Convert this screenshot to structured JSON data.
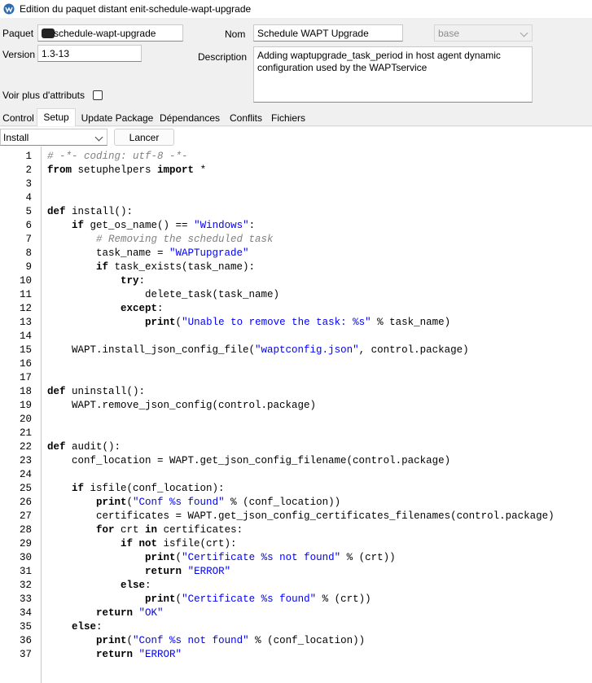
{
  "window": {
    "title": "Edition du paquet distant enit-schedule-wapt-upgrade"
  },
  "form": {
    "paquet_label": "Paquet",
    "paquet_value": "schedule-wapt-upgrade",
    "version_label": "Version",
    "version_value": "1.3-13",
    "nom_label": "Nom",
    "nom_value": "Schedule WAPT Upgrade",
    "base_value": "base",
    "description_label": "Description",
    "description_value": "Adding waptupgrade_task_period in host agent dynamic configuration used by the WAPTservice",
    "more_attrs_label": "Voir plus d'attributs",
    "more_attrs_checked": false
  },
  "tabs": [
    {
      "label": "Control",
      "active": false
    },
    {
      "label": "Setup",
      "active": true
    },
    {
      "label": "Update Package",
      "active": false
    },
    {
      "label": "Dépendances",
      "active": false
    },
    {
      "label": "Conflits",
      "active": false
    },
    {
      "label": "Fichiers",
      "active": false
    }
  ],
  "toolbar": {
    "action_value": "Install",
    "run_label": "Lancer"
  },
  "editor": {
    "lines": [
      [
        [
          "c",
          "# -*- coding: utf-8 -*-"
        ]
      ],
      [
        [
          "k",
          "from"
        ],
        [
          "p",
          " setuphelpers "
        ],
        [
          "k",
          "import"
        ],
        [
          "p",
          " *"
        ]
      ],
      [],
      [],
      [
        [
          "k",
          "def"
        ],
        [
          "p",
          " install():"
        ]
      ],
      [
        [
          "p",
          "    "
        ],
        [
          "k",
          "if"
        ],
        [
          "p",
          " get_os_name() == "
        ],
        [
          "s",
          "\"Windows\""
        ],
        [
          "p",
          ":"
        ]
      ],
      [
        [
          "p",
          "        "
        ],
        [
          "c",
          "# Removing the scheduled task"
        ]
      ],
      [
        [
          "p",
          "        task_name = "
        ],
        [
          "s",
          "\"WAPTupgrade\""
        ]
      ],
      [
        [
          "p",
          "        "
        ],
        [
          "k",
          "if"
        ],
        [
          "p",
          " task_exists(task_name):"
        ]
      ],
      [
        [
          "p",
          "            "
        ],
        [
          "k",
          "try"
        ],
        [
          "p",
          ":"
        ]
      ],
      [
        [
          "p",
          "                delete_task(task_name)"
        ]
      ],
      [
        [
          "p",
          "            "
        ],
        [
          "k",
          "except"
        ],
        [
          "p",
          ":"
        ]
      ],
      [
        [
          "p",
          "                "
        ],
        [
          "k",
          "print"
        ],
        [
          "p",
          "("
        ],
        [
          "s",
          "\"Unable to remove the task: %s\""
        ],
        [
          "p",
          " % task_name)"
        ]
      ],
      [],
      [
        [
          "p",
          "    WAPT.install_json_config_file("
        ],
        [
          "s",
          "\"waptconfig.json\""
        ],
        [
          "p",
          ", control.package)"
        ]
      ],
      [],
      [],
      [
        [
          "k",
          "def"
        ],
        [
          "p",
          " uninstall():"
        ]
      ],
      [
        [
          "p",
          "    WAPT.remove_json_config(control.package)"
        ]
      ],
      [],
      [],
      [
        [
          "k",
          "def"
        ],
        [
          "p",
          " audit():"
        ]
      ],
      [
        [
          "p",
          "    conf_location = WAPT.get_json_config_filename(control.package)"
        ]
      ],
      [],
      [
        [
          "p",
          "    "
        ],
        [
          "k",
          "if"
        ],
        [
          "p",
          " isfile(conf_location):"
        ]
      ],
      [
        [
          "p",
          "        "
        ],
        [
          "k",
          "print"
        ],
        [
          "p",
          "("
        ],
        [
          "s",
          "\"Conf %s found\""
        ],
        [
          "p",
          " % (conf_location))"
        ]
      ],
      [
        [
          "p",
          "        certificates = WAPT.get_json_config_certificates_filenames(control.package)"
        ]
      ],
      [
        [
          "p",
          "        "
        ],
        [
          "k",
          "for"
        ],
        [
          "p",
          " crt "
        ],
        [
          "k",
          "in"
        ],
        [
          "p",
          " certificates:"
        ]
      ],
      [
        [
          "p",
          "            "
        ],
        [
          "k",
          "if not"
        ],
        [
          "p",
          " isfile(crt):"
        ]
      ],
      [
        [
          "p",
          "                "
        ],
        [
          "k",
          "print"
        ],
        [
          "p",
          "("
        ],
        [
          "s",
          "\"Certificate %s not found\""
        ],
        [
          "p",
          " % (crt))"
        ]
      ],
      [
        [
          "p",
          "                "
        ],
        [
          "k",
          "return"
        ],
        [
          "p",
          " "
        ],
        [
          "s",
          "\"ERROR\""
        ]
      ],
      [
        [
          "p",
          "            "
        ],
        [
          "k",
          "else"
        ],
        [
          "p",
          ":"
        ]
      ],
      [
        [
          "p",
          "                "
        ],
        [
          "k",
          "print"
        ],
        [
          "p",
          "("
        ],
        [
          "s",
          "\"Certificate %s found\""
        ],
        [
          "p",
          " % (crt))"
        ]
      ],
      [
        [
          "p",
          "        "
        ],
        [
          "k",
          "return"
        ],
        [
          "p",
          " "
        ],
        [
          "s",
          "\"OK\""
        ]
      ],
      [
        [
          "p",
          "    "
        ],
        [
          "k",
          "else"
        ],
        [
          "p",
          ":"
        ]
      ],
      [
        [
          "p",
          "        "
        ],
        [
          "k",
          "print"
        ],
        [
          "p",
          "("
        ],
        [
          "s",
          "\"Conf %s not found\""
        ],
        [
          "p",
          " % (conf_location))"
        ]
      ],
      [
        [
          "p",
          "        "
        ],
        [
          "k",
          "return"
        ],
        [
          "p",
          " "
        ],
        [
          "s",
          "\"ERROR\""
        ]
      ]
    ]
  },
  "colors": {
    "keyword": "#000000",
    "string": "#0000ff",
    "comment": "#808080"
  }
}
